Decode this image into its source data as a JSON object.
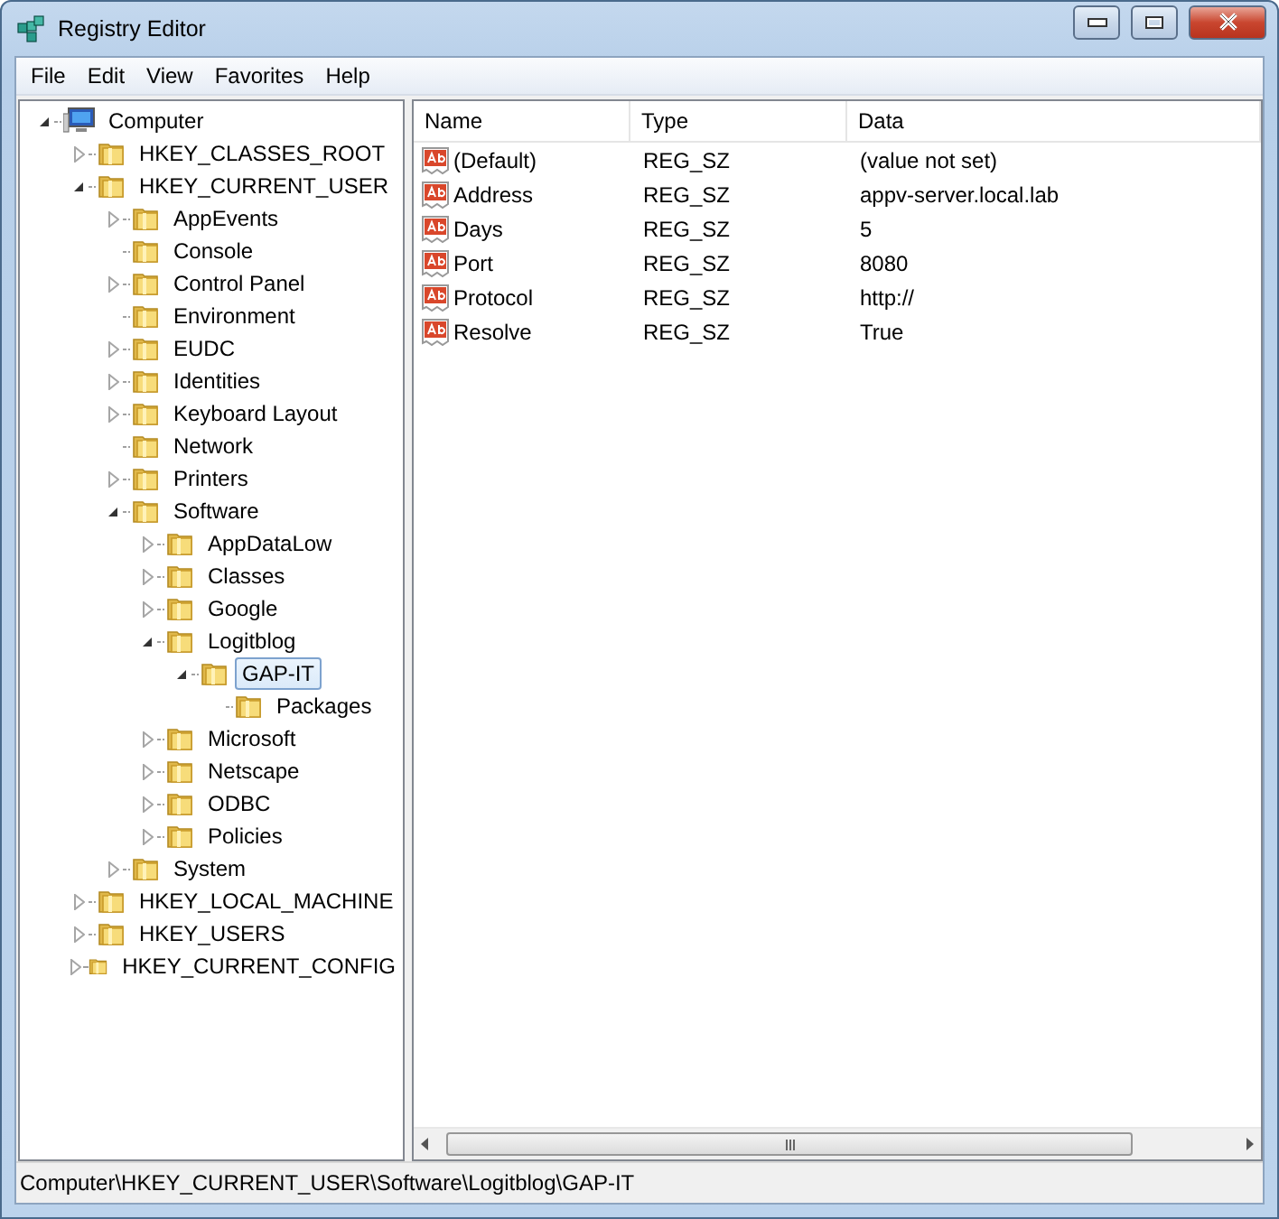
{
  "window": {
    "title": "Registry Editor"
  },
  "menu": [
    "File",
    "Edit",
    "View",
    "Favorites",
    "Help"
  ],
  "tree": [
    {
      "label": "Computer",
      "kind": "computer",
      "has_children": true,
      "expanded": true,
      "selected": false,
      "children": [
        {
          "label": "HKEY_CLASSES_ROOT",
          "kind": "folder",
          "has_children": true,
          "expanded": false,
          "selected": false
        },
        {
          "label": "HKEY_CURRENT_USER",
          "kind": "folder",
          "has_children": true,
          "expanded": true,
          "selected": false,
          "children": [
            {
              "label": "AppEvents",
              "kind": "folder",
              "has_children": true,
              "expanded": false,
              "selected": false
            },
            {
              "label": "Console",
              "kind": "folder",
              "has_children": false,
              "expanded": false,
              "selected": false
            },
            {
              "label": "Control Panel",
              "kind": "folder",
              "has_children": true,
              "expanded": false,
              "selected": false
            },
            {
              "label": "Environment",
              "kind": "folder",
              "has_children": false,
              "expanded": false,
              "selected": false
            },
            {
              "label": "EUDC",
              "kind": "folder",
              "has_children": true,
              "expanded": false,
              "selected": false
            },
            {
              "label": "Identities",
              "kind": "folder",
              "has_children": true,
              "expanded": false,
              "selected": false
            },
            {
              "label": "Keyboard Layout",
              "kind": "folder",
              "has_children": true,
              "expanded": false,
              "selected": false
            },
            {
              "label": "Network",
              "kind": "folder",
              "has_children": false,
              "expanded": false,
              "selected": false
            },
            {
              "label": "Printers",
              "kind": "folder",
              "has_children": true,
              "expanded": false,
              "selected": false
            },
            {
              "label": "Software",
              "kind": "folder",
              "has_children": true,
              "expanded": true,
              "selected": false,
              "children": [
                {
                  "label": "AppDataLow",
                  "kind": "folder",
                  "has_children": true,
                  "expanded": false,
                  "selected": false
                },
                {
                  "label": "Classes",
                  "kind": "folder",
                  "has_children": true,
                  "expanded": false,
                  "selected": false
                },
                {
                  "label": "Google",
                  "kind": "folder",
                  "has_children": true,
                  "expanded": false,
                  "selected": false
                },
                {
                  "label": "Logitblog",
                  "kind": "folder",
                  "has_children": true,
                  "expanded": true,
                  "selected": false,
                  "children": [
                    {
                      "label": "GAP-IT",
                      "kind": "folder",
                      "has_children": true,
                      "expanded": true,
                      "selected": true,
                      "children": [
                        {
                          "label": "Packages",
                          "kind": "folder",
                          "has_children": false,
                          "expanded": false,
                          "selected": false
                        }
                      ]
                    }
                  ]
                },
                {
                  "label": "Microsoft",
                  "kind": "folder",
                  "has_children": true,
                  "expanded": false,
                  "selected": false
                },
                {
                  "label": "Netscape",
                  "kind": "folder",
                  "has_children": true,
                  "expanded": false,
                  "selected": false
                },
                {
                  "label": "ODBC",
                  "kind": "folder",
                  "has_children": true,
                  "expanded": false,
                  "selected": false
                },
                {
                  "label": "Policies",
                  "kind": "folder",
                  "has_children": true,
                  "expanded": false,
                  "selected": false
                }
              ]
            },
            {
              "label": "System",
              "kind": "folder",
              "has_children": true,
              "expanded": false,
              "selected": false
            }
          ]
        },
        {
          "label": "HKEY_LOCAL_MACHINE",
          "kind": "folder",
          "has_children": true,
          "expanded": false,
          "selected": false
        },
        {
          "label": "HKEY_USERS",
          "kind": "folder",
          "has_children": true,
          "expanded": false,
          "selected": false
        },
        {
          "label": "HKEY_CURRENT_CONFIG",
          "kind": "folder",
          "has_children": true,
          "expanded": false,
          "selected": false
        }
      ]
    }
  ],
  "table": {
    "columns": [
      "Name",
      "Type",
      "Data"
    ],
    "rows": [
      {
        "name": "(Default)",
        "type": "REG_SZ",
        "data": "(value not set)"
      },
      {
        "name": "Address",
        "type": "REG_SZ",
        "data": "appv-server.local.lab"
      },
      {
        "name": "Days",
        "type": "REG_SZ",
        "data": "5"
      },
      {
        "name": "Port",
        "type": "REG_SZ",
        "data": "8080"
      },
      {
        "name": "Protocol",
        "type": "REG_SZ",
        "data": "http://"
      },
      {
        "name": "Resolve",
        "type": "REG_SZ",
        "data": "True"
      }
    ]
  },
  "status_bar": "Computer\\HKEY_CURRENT_USER\\Software\\Logitblog\\GAP-IT"
}
